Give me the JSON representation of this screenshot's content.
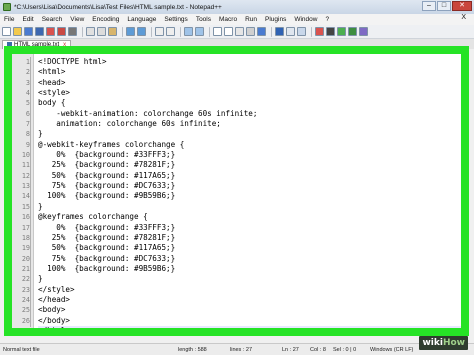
{
  "window": {
    "title": "*C:\\Users\\Lisa\\Documents\\Lisa\\Test Files\\HTML sample.txt - Notepad++",
    "controls": {
      "minimize": "–",
      "maximize": "□",
      "close": "✕"
    }
  },
  "menu": {
    "items": [
      "File",
      "Edit",
      "Search",
      "View",
      "Encoding",
      "Language",
      "Settings",
      "Tools",
      "Macro",
      "Run",
      "Plugins",
      "Window",
      "?"
    ],
    "close_glyph": "X"
  },
  "tab": {
    "label": "HTML sample.txt",
    "close_glyph": "x"
  },
  "editor": {
    "lines": [
      {
        "n": "1",
        "text": "<!DOCTYPE html>"
      },
      {
        "n": "2",
        "text": "<html>"
      },
      {
        "n": "3",
        "text": "<head>"
      },
      {
        "n": "4",
        "text": "<style>"
      },
      {
        "n": "5",
        "text": "body {"
      },
      {
        "n": "6",
        "text": "    -webkit-animation: colorchange 60s infinite;"
      },
      {
        "n": "7",
        "text": "    animation: colorchange 60s infinite;"
      },
      {
        "n": "8",
        "text": "}"
      },
      {
        "n": "9",
        "text": "@-webkit-keyframes colorchange {"
      },
      {
        "n": "10",
        "text": "    0%  {background: #33FFF3;}"
      },
      {
        "n": "11",
        "text": "   25%  {background: #78281F;}"
      },
      {
        "n": "12",
        "text": "   50%  {background: #117A65;}"
      },
      {
        "n": "13",
        "text": "   75%  {background: #DC7633;}"
      },
      {
        "n": "14",
        "text": "  100%  {background: #9B59B6;}"
      },
      {
        "n": "15",
        "text": "}"
      },
      {
        "n": "16",
        "text": "@keyframes colorchange {"
      },
      {
        "n": "17",
        "text": "    0%  {background: #33FFF3;}"
      },
      {
        "n": "18",
        "text": "   25%  {background: #78281F;}"
      },
      {
        "n": "19",
        "text": "   50%  {background: #117A65;}"
      },
      {
        "n": "20",
        "text": "   75%  {background: #DC7633;}"
      },
      {
        "n": "21",
        "text": "  100%  {background: #9B59B6;}"
      },
      {
        "n": "22",
        "text": "}"
      },
      {
        "n": "23",
        "text": "</style>"
      },
      {
        "n": "24",
        "text": "</head>"
      },
      {
        "n": "25",
        "text": "<body>"
      },
      {
        "n": "26",
        "text": "</body>"
      },
      {
        "n": "27",
        "text": "</html>"
      }
    ],
    "current_line": 27
  },
  "status": {
    "file_type": "Normal text file",
    "length": "length : 588",
    "lines": "lines : 27",
    "ln": "Ln : 27",
    "col": "Col : 8",
    "sel": "Sel : 0 | 0",
    "eol": "Windows (CR LF)"
  },
  "watermark": {
    "wiki": "wiki",
    "how": "How"
  },
  "colors": {
    "highlight": "#26e326",
    "accent": "#3a6ea5"
  }
}
